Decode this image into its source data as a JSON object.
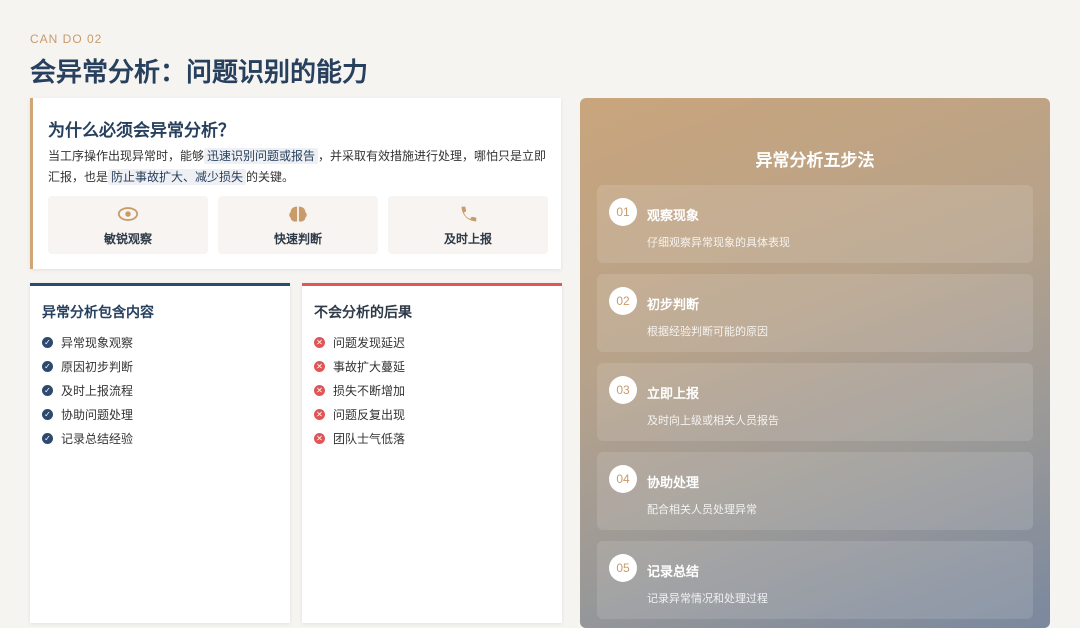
{
  "header": {
    "kicker": "CAN DO 02",
    "title": "会异常分析：问题识别的能力"
  },
  "why": {
    "heading": "为什么必须会异常分析？",
    "p1": "当工序操作出现异常时，能够",
    "hl1": "迅速识别问题或报告",
    "p2": "，并采取有效措施进行处理，哪怕只是立即汇报，也是",
    "hl2": "防止事故扩大、减少损失",
    "p3": "的关键。",
    "pills": [
      {
        "label": "敏锐观察",
        "icon": "eye-icon"
      },
      {
        "label": "快速判断",
        "icon": "brain-icon"
      },
      {
        "label": "及时上报",
        "icon": "phone-icon"
      }
    ]
  },
  "contents": {
    "heading": "异常分析包含内容",
    "items": [
      "异常现象观察",
      "原因初步判断",
      "及时上报流程",
      "协助问题处理",
      "记录总结经验"
    ]
  },
  "consequences": {
    "heading": "不会分析的后果",
    "items": [
      "问题发现延迟",
      "事故扩大蔓延",
      "损失不断增加",
      "问题反复出现",
      "团队士气低落"
    ]
  },
  "steps": {
    "heading": "异常分析五步法",
    "items": [
      {
        "num": "01",
        "title": "观察现象",
        "desc": "仔细观察异常现象的具体表现"
      },
      {
        "num": "02",
        "title": "初步判断",
        "desc": "根据经验判断可能的原因"
      },
      {
        "num": "03",
        "title": "立即上报",
        "desc": "及时向上级或相关人员报告"
      },
      {
        "num": "04",
        "title": "协助处理",
        "desc": "配合相关人员处理异常"
      },
      {
        "num": "05",
        "title": "记录总结",
        "desc": "记录异常情况和处理过程"
      }
    ]
  },
  "colors": {
    "navy": "#27405e",
    "accent": "#cfa777",
    "danger": "#e05555"
  }
}
